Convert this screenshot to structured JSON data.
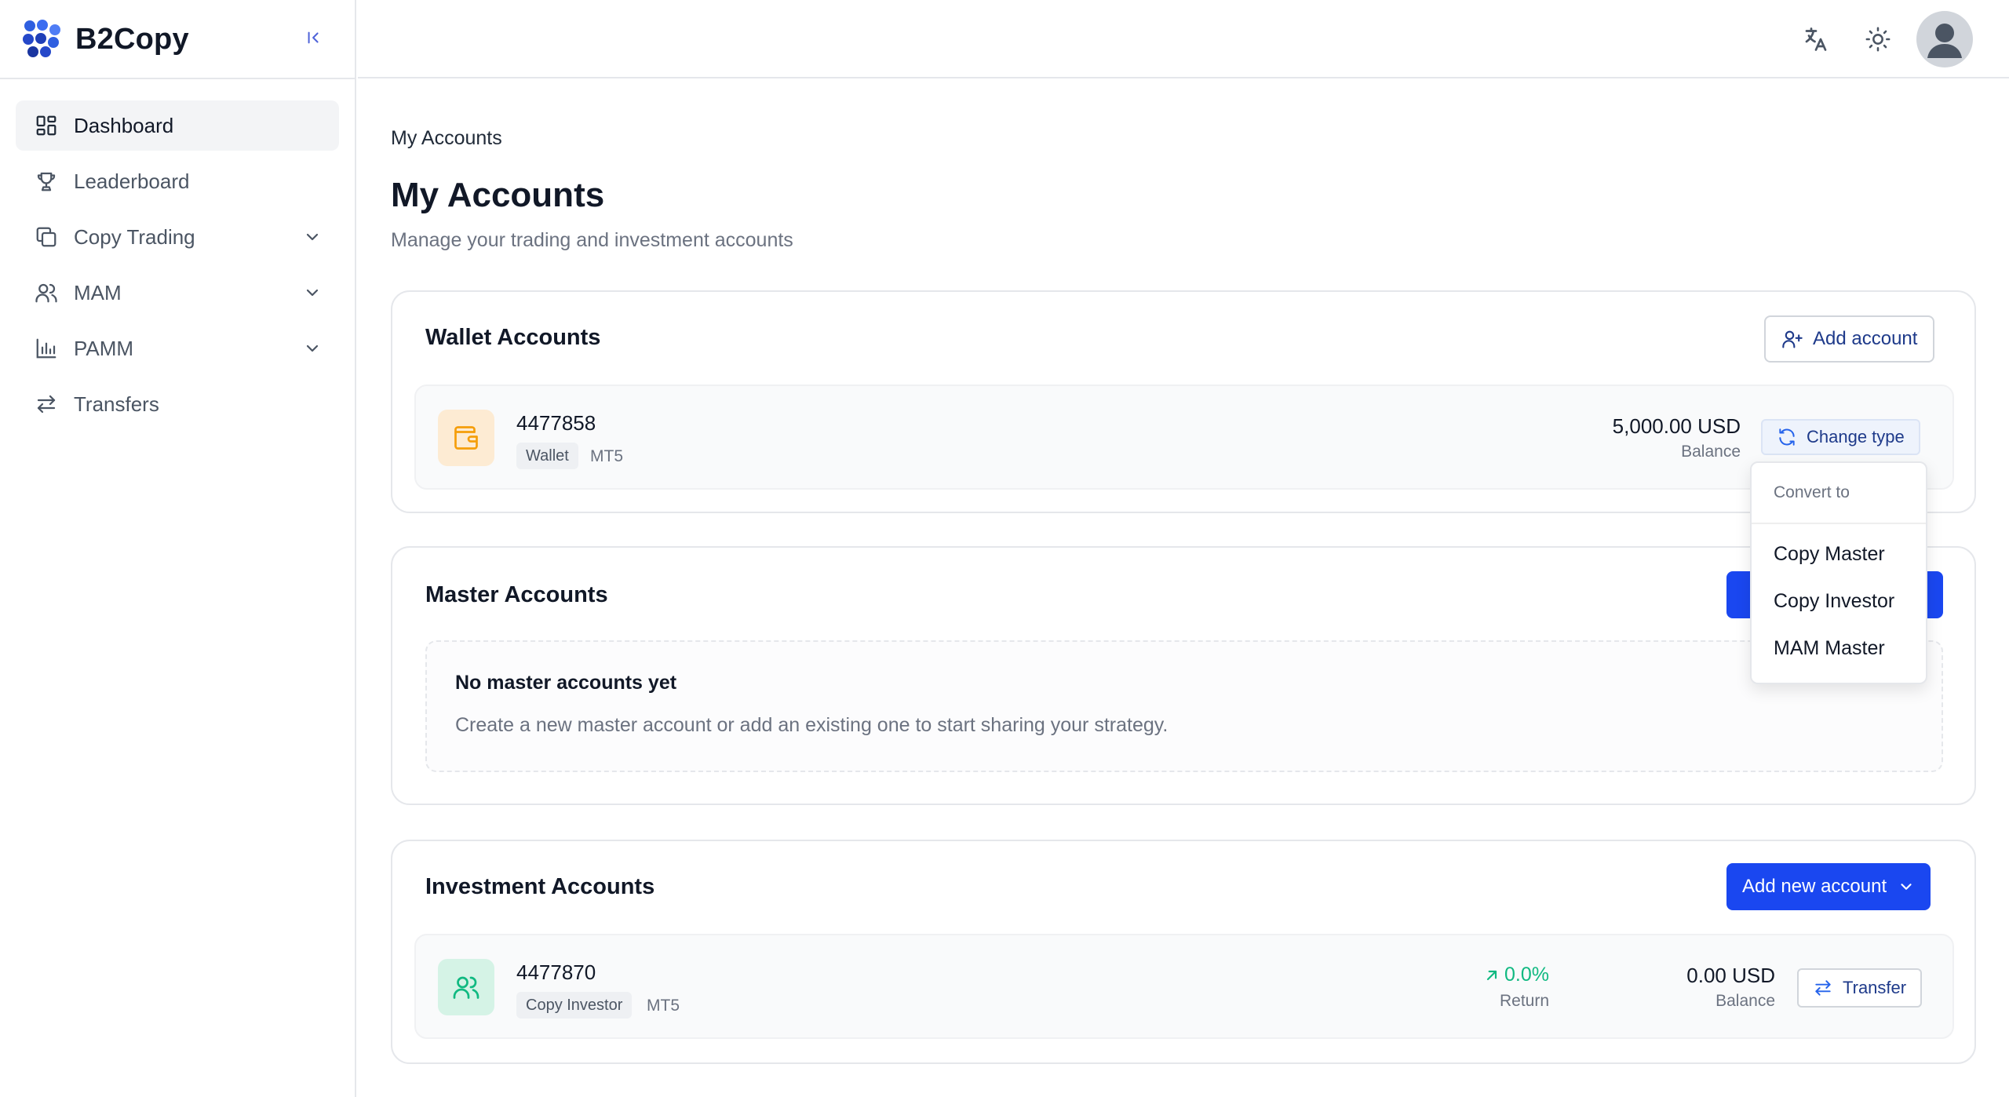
{
  "app": {
    "name": "B2Copy"
  },
  "sidebar": {
    "items": [
      {
        "label": "Dashboard",
        "icon": "dashboard-icon",
        "active": true
      },
      {
        "label": "Leaderboard",
        "icon": "trophy-icon"
      },
      {
        "label": "Copy Trading",
        "icon": "copy-icon",
        "expandable": true
      },
      {
        "label": "MAM",
        "icon": "users-icon",
        "expandable": true
      },
      {
        "label": "PAMM",
        "icon": "bar-chart-icon",
        "expandable": true
      },
      {
        "label": "Transfers",
        "icon": "arrows-left-right-icon"
      }
    ]
  },
  "header": {
    "icons": [
      "translate-icon",
      "sun-icon",
      "avatar"
    ]
  },
  "page": {
    "breadcrumb": "My Accounts",
    "title": "My Accounts",
    "subtitle": "Manage your trading and investment accounts"
  },
  "wallet": {
    "title": "Wallet Accounts",
    "add_label": "Add account",
    "account": {
      "number": "4477858",
      "type": "Wallet",
      "platform": "MT5",
      "balance": "5,000.00 USD",
      "balance_label": "Balance",
      "change_label": "Change type"
    }
  },
  "dropdown": {
    "header": "Convert to",
    "options": [
      "Copy Master",
      "Copy Investor",
      "MAM Master"
    ]
  },
  "master": {
    "title": "Master Accounts",
    "empty_title": "No master accounts yet",
    "empty_text": "Create a new master account or add an existing one to start sharing your strategy."
  },
  "investment": {
    "title": "Investment Accounts",
    "add_label": "Add new account",
    "account": {
      "number": "4477870",
      "type": "Copy Investor",
      "platform": "MT5",
      "return_value": "0.0%",
      "return_label": "Return",
      "balance": "0.00 USD",
      "balance_label": "Balance",
      "transfer_label": "Transfer"
    }
  },
  "colors": {
    "primary": "#1a47f0",
    "wallet_icon_bg": "#fdebd3",
    "wallet_icon": "#f59e0b",
    "investor_icon_bg": "#d5f3e6",
    "investor_icon": "#10b981",
    "return_positive": "#10b981"
  }
}
